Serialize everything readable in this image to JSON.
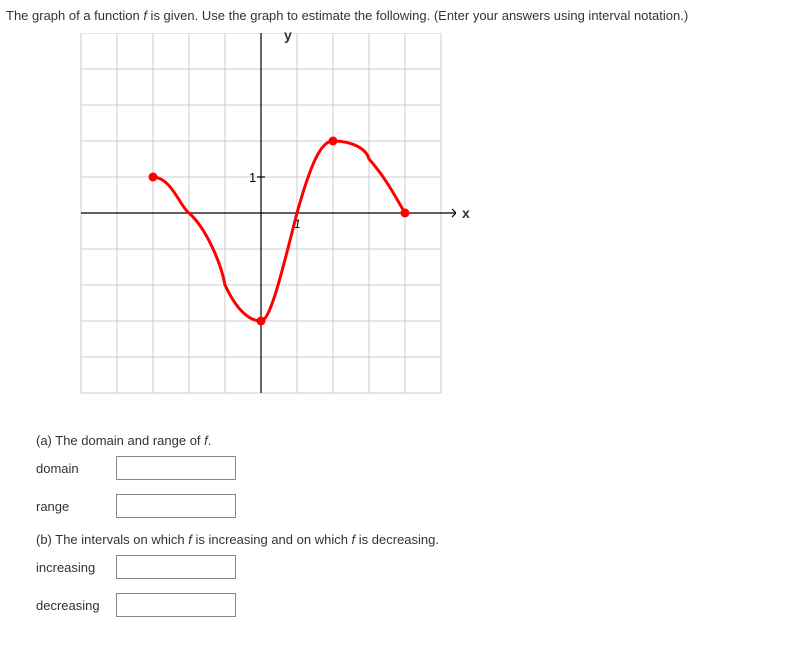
{
  "prompt": {
    "text_before_f": "The graph of a function ",
    "f": "f",
    "text_after_f": " is given. Use the graph to estimate the following. (Enter your answers using interval notation.)"
  },
  "axis": {
    "x": "x",
    "y": "y",
    "tick_y": "1",
    "tick_x": "1"
  },
  "parts": {
    "a": {
      "label_before": "(a) The domain and range of ",
      "fn": "f",
      "label_after": ".",
      "rows": [
        {
          "label": "domain",
          "name": "domain-input"
        },
        {
          "label": "range",
          "name": "range-input"
        }
      ]
    },
    "b": {
      "label_before": "(b) The intervals on which ",
      "fn": "f",
      "mid": " is increasing and on which ",
      "fn2": "f",
      "label_after": " is decreasing.",
      "rows": [
        {
          "label": "increasing",
          "name": "increasing-input"
        },
        {
          "label": "decreasing",
          "name": "decreasing-input"
        }
      ]
    }
  },
  "chart_data": {
    "type": "line",
    "title": "",
    "xlabel": "x",
    "ylabel": "y",
    "xlim": [
      -5,
      5
    ],
    "ylim": [
      -5,
      5
    ],
    "grid": true,
    "tick_step": 1,
    "annotations": [
      "y tick at 1",
      "x tick at 1"
    ],
    "series": [
      {
        "name": "f",
        "color": "#ff0000",
        "endpoints": [
          {
            "x": -3,
            "y": 1,
            "closed": true
          },
          {
            "x": 4,
            "y": 0,
            "closed": true
          }
        ],
        "sample_points": [
          {
            "x": -3,
            "y": 1
          },
          {
            "x": -2,
            "y": 0
          },
          {
            "x": -1,
            "y": -2
          },
          {
            "x": 0,
            "y": -3
          },
          {
            "x": 1,
            "y": 0
          },
          {
            "x": 2,
            "y": 2
          },
          {
            "x": 3,
            "y": 1.5
          },
          {
            "x": 4,
            "y": 0
          }
        ],
        "local_min": {
          "x": 0,
          "y": -3
        },
        "local_max": {
          "x": 2,
          "y": 2
        }
      }
    ]
  }
}
